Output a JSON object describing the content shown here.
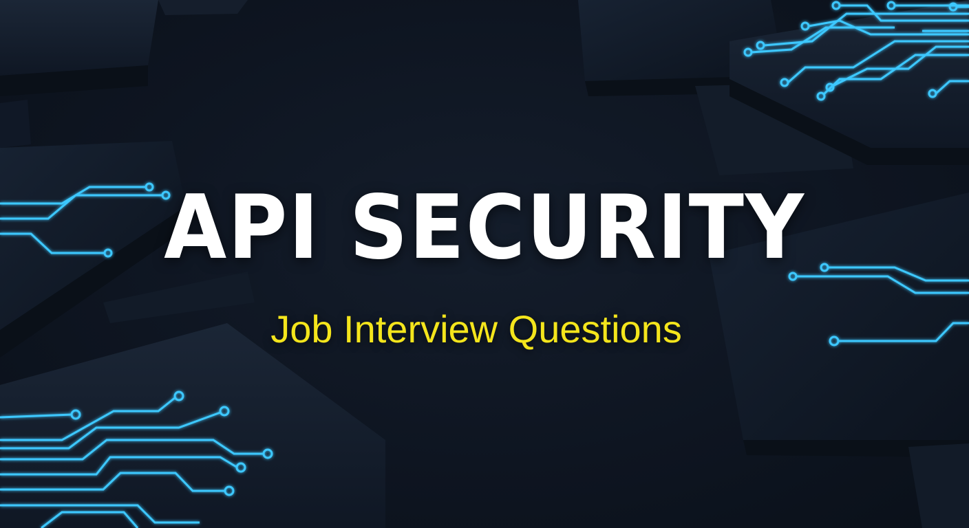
{
  "title": "API SECURITY",
  "subtitle": "Job Interview Questions",
  "colors": {
    "background": "#0e1521",
    "title": "#ffffff",
    "subtitle": "#f4e51c",
    "circuit_glow": "#3cc8ff"
  }
}
